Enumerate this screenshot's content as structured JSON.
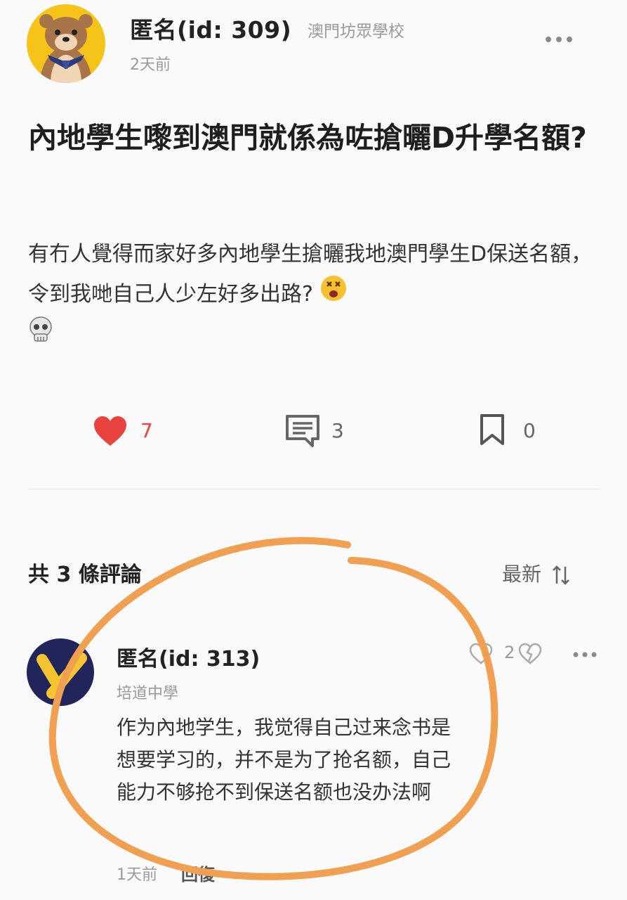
{
  "post": {
    "author": "匿名(id: 309)",
    "school": "澳門坊眾學校",
    "time": "2天前",
    "title": "內地學生嚟到澳門就係為咗搶曬D升學名額?",
    "body": "有冇人覺得而家好多內地學生搶曬我地澳門學生D保送名額，令到我哋自己人少左好多出路?",
    "emojis": [
      "dizzy-face-emoji",
      "skull-emoji"
    ],
    "actions": {
      "likes": "7",
      "comments": "3",
      "bookmarks": "0"
    }
  },
  "comments_section": {
    "title": "共 3 條評論",
    "sort_label": "最新"
  },
  "comment": {
    "author": "匿名(id: 313)",
    "school": "培道中學",
    "body": "作为內地学生，我觉得自己过来念书是想要学习的，并不是为了抢名额，自己能力不够抢不到保送名额也没办法啊",
    "likes": "2",
    "time": "1天前",
    "reply_label": "回復"
  },
  "colors": {
    "heart": "#e8433e",
    "highlight_circle": "#f0a050",
    "avatar_post_bg": "#f6c419",
    "avatar_comment_bg": "#21255b"
  }
}
